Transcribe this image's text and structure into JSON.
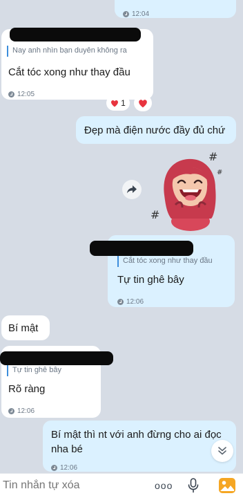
{
  "messages": [
    {
      "id": "m0",
      "time": "12:04"
    },
    {
      "id": "m1",
      "quote": "Nay anh nhìn bạn duyên không ra",
      "text": "Cắt tóc xong như thay đầu",
      "time": "12:05",
      "reactions": {
        "count": "1"
      }
    },
    {
      "id": "m2",
      "text": "Đẹp mà điện nước đầy đủ chứ"
    },
    {
      "id": "m3",
      "sticker": "laughing-red-hood-girl"
    },
    {
      "id": "m4",
      "quote": "Cắt tóc xong như thay đầu",
      "text": "Tự tin ghê bây",
      "time": "12:06"
    },
    {
      "id": "m5",
      "text": "Bí mật"
    },
    {
      "id": "m6",
      "quote": "Tự tin ghê bây",
      "text": "Rõ ràng",
      "time": "12:06"
    },
    {
      "id": "m7",
      "text_line1": "Bí mật thì nt với anh đừng cho ai đọc",
      "text_line2": "nha bé",
      "time": "12:06"
    }
  ],
  "composer": {
    "placeholder": "Tin nhắn tự xóa",
    "more_label": "ooo"
  },
  "colors": {
    "incoming": "#ffffff",
    "outgoing": "#dbf1ff",
    "background": "#d6dce5",
    "accent": "#3c8ddb",
    "heart": "#e8343f"
  },
  "icons": [
    "clock-icon",
    "heart-icon",
    "forward-icon",
    "scroll-down-icon",
    "microphone-icon",
    "gallery-icon"
  ]
}
